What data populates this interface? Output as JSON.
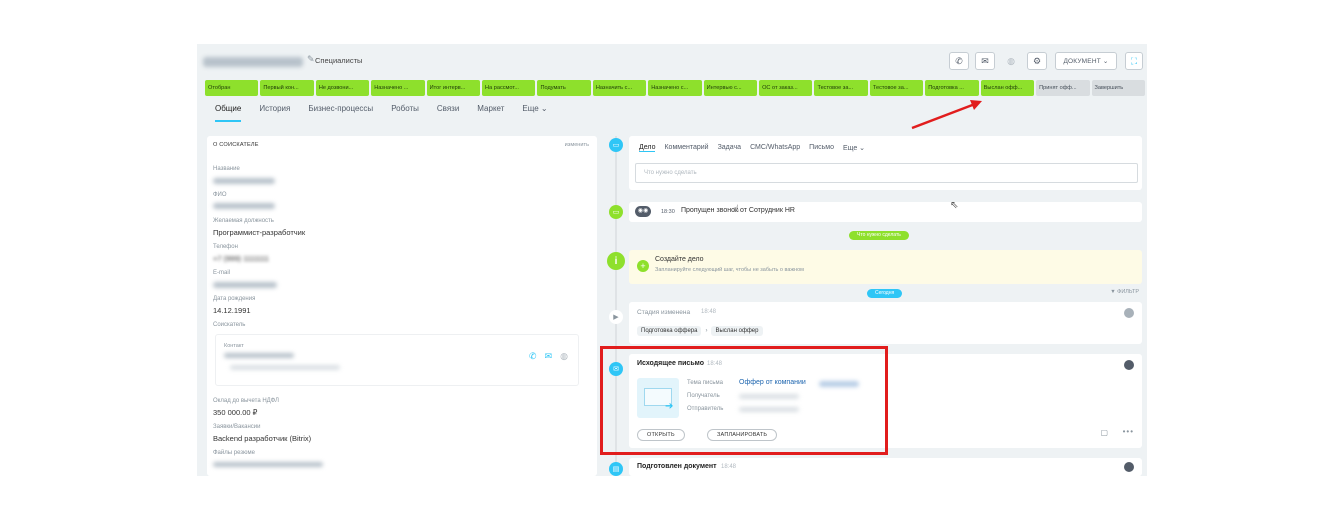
{
  "header": {
    "breadcrumb": "Специалисты",
    "doc_button": "ДОКУМЕНТ"
  },
  "stages": [
    {
      "label": "Отобран",
      "active": true
    },
    {
      "label": "Первый кон...",
      "active": true
    },
    {
      "label": "Не дозвони...",
      "active": true
    },
    {
      "label": "Назначено ...",
      "active": true
    },
    {
      "label": "Итог интерв...",
      "active": true
    },
    {
      "label": "На рассмот...",
      "active": true
    },
    {
      "label": "Подумать",
      "active": true
    },
    {
      "label": "Назначить с...",
      "active": true
    },
    {
      "label": "Назначено с...",
      "active": true
    },
    {
      "label": "Интервью с...",
      "active": true
    },
    {
      "label": "ОС от заказ...",
      "active": true
    },
    {
      "label": "Тестовое за...",
      "active": true
    },
    {
      "label": "Тестовое за...",
      "active": true
    },
    {
      "label": "Подготовка ...",
      "active": true
    },
    {
      "label": "Выслан офф...",
      "active": true
    },
    {
      "label": "Принят офф...",
      "active": false
    },
    {
      "label": "Завершить",
      "active": false
    }
  ],
  "tabs": [
    "Общие",
    "История",
    "Бизнес-процессы",
    "Роботы",
    "Связи",
    "Маркет",
    "Еще ⌄"
  ],
  "left_panel": {
    "heading": "О СОИСКАТЕЛЕ",
    "edit": "изменить",
    "fields": {
      "name_label": "Название",
      "fio_label": "ФИО",
      "position_label": "Желаемая должность",
      "position_value": "Программист-разработчик",
      "phone_label": "Телефон",
      "phone_value": "+7 (999) 1111111",
      "email_label": "E-mail",
      "birth_label": "Дата рождения",
      "birth_value": "14.12.1991",
      "candidate_label": "Соискатель",
      "contact_label": "Контакт",
      "salary_label": "Оклад до вычета НДФЛ",
      "salary_value": "350 000.00 ₽",
      "vacancy_label": "Заявки/Вакансии",
      "vacancy_value": "Backend разработчик (Bitrix)",
      "files_label": "Файлы резюме"
    }
  },
  "timeline": {
    "new_tabs": [
      "Дело",
      "Комментарий",
      "Задача",
      "СМС/WhatsApp",
      "Письмо",
      "Еще ⌄"
    ],
    "new_placeholder": "Что нужно сделать",
    "missed_time": "18:30",
    "missed_text": "Пропущен звонок от Сотрудник HR",
    "todo_badge": "Что нужно сделать",
    "create_title": "Создайте дело",
    "create_sub": "Запланируйте следующий шаг, чтобы не забыть о важном",
    "today_badge": "Сегодня",
    "filter": "▼ ФИЛЬТР",
    "stage_changed_title": "Стадия изменена",
    "stage_changed_time": "18:48",
    "stage_from": "Подготовка оффера",
    "stage_to": "Выслан оффер",
    "email_title": "Исходящее письмо",
    "email_time": "18:48",
    "subject_label": "Тема письма",
    "subject_value": "Оффер от компании",
    "recipient_label": "Получатель",
    "sender_label": "Отправитель",
    "open_btn": "ОТКРЫТЬ",
    "schedule_btn": "ЗАПЛАНИРОВАТЬ",
    "doc_title": "Подготовлен документ",
    "doc_time": "18:48"
  },
  "colors": {
    "stage_active": "#8ee02c",
    "stage_inactive": "#d9dde0",
    "accent": "#2fc6f6",
    "annotation_red": "#e11d1d"
  }
}
